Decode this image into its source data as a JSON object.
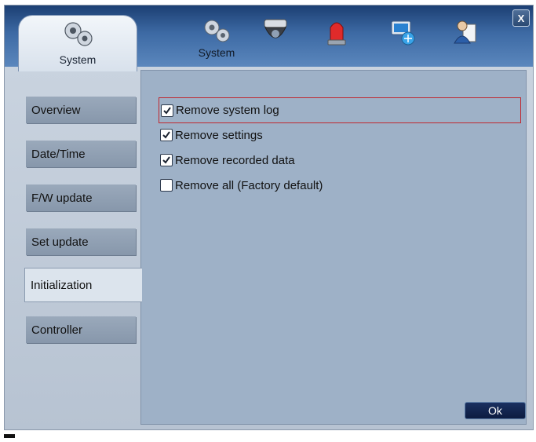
{
  "header": {
    "active_tab_label": "System",
    "nav_system_label": "System",
    "close_label": "X",
    "nav_icons": [
      "gear-icon",
      "camera-icon",
      "alarm-icon",
      "network-icon",
      "user-icon"
    ]
  },
  "sidebar": {
    "items": [
      {
        "label": "Overview",
        "selected": false
      },
      {
        "label": "Date/Time",
        "selected": false
      },
      {
        "label": "F/W update",
        "selected": false
      },
      {
        "label": "Set update",
        "selected": false
      },
      {
        "label": "Initialization",
        "selected": true
      },
      {
        "label": "Controller",
        "selected": false
      }
    ]
  },
  "content": {
    "options": [
      {
        "label": "Remove system log",
        "checked": true,
        "focused": true
      },
      {
        "label": "Remove settings",
        "checked": true,
        "focused": false
      },
      {
        "label": "Remove recorded data",
        "checked": true,
        "focused": false
      },
      {
        "label": "Remove all (Factory default)",
        "checked": false,
        "focused": false
      }
    ],
    "ok_label": "Ok"
  },
  "colors": {
    "accent_focus": "#c0282f",
    "panel_bg": "#9eb1c7",
    "topbar": "#3d6aa4"
  }
}
